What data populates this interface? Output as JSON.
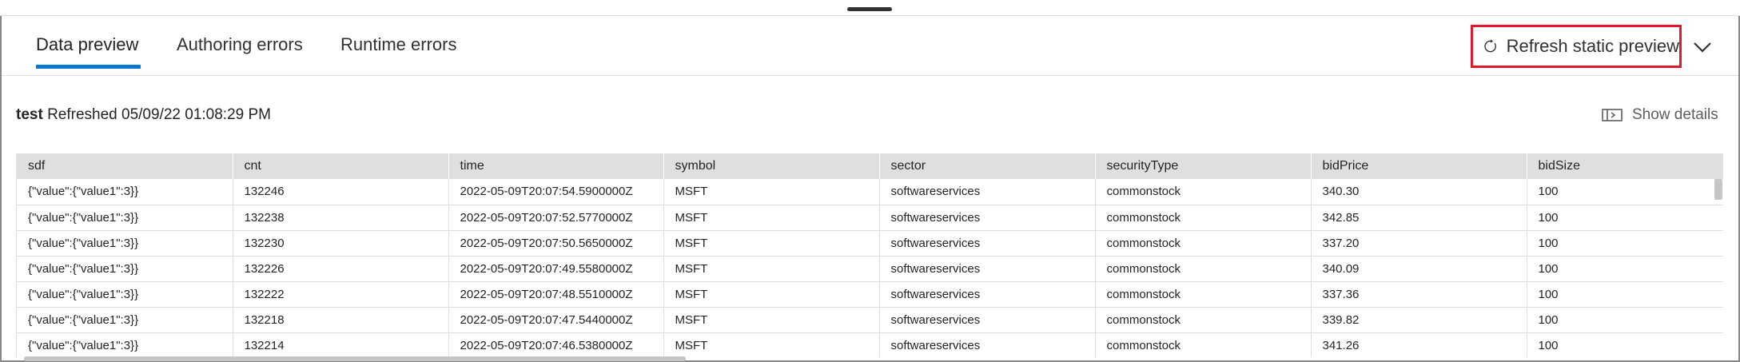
{
  "tabs": [
    {
      "label": "Data preview",
      "active": true
    },
    {
      "label": "Authoring errors",
      "active": false
    },
    {
      "label": "Runtime errors",
      "active": false
    }
  ],
  "toolbar": {
    "refresh_label": "Refresh static preview",
    "refresh_icon": "refresh-icon",
    "more_icon": "chevron-down-icon"
  },
  "status": {
    "name": "test",
    "refreshed": "Refreshed 05/09/22 01:08:29 PM"
  },
  "details": {
    "label": "Show details",
    "icon": "details-panel-icon"
  },
  "table": {
    "columns": [
      "sdf",
      "cnt",
      "time",
      "symbol",
      "sector",
      "securityType",
      "bidPrice",
      "bidSize"
    ],
    "rows": [
      [
        "{\"value\":{\"value1\":3}}",
        "132246",
        "2022-05-09T20:07:54.5900000Z",
        "MSFT",
        "softwareservices",
        "commonstock",
        "340.30",
        "100"
      ],
      [
        "{\"value\":{\"value1\":3}}",
        "132238",
        "2022-05-09T20:07:52.5770000Z",
        "MSFT",
        "softwareservices",
        "commonstock",
        "342.85",
        "100"
      ],
      [
        "{\"value\":{\"value1\":3}}",
        "132230",
        "2022-05-09T20:07:50.5650000Z",
        "MSFT",
        "softwareservices",
        "commonstock",
        "337.20",
        "100"
      ],
      [
        "{\"value\":{\"value1\":3}}",
        "132226",
        "2022-05-09T20:07:49.5580000Z",
        "MSFT",
        "softwareservices",
        "commonstock",
        "340.09",
        "100"
      ],
      [
        "{\"value\":{\"value1\":3}}",
        "132222",
        "2022-05-09T20:07:48.5510000Z",
        "MSFT",
        "softwareservices",
        "commonstock",
        "337.36",
        "100"
      ],
      [
        "{\"value\":{\"value1\":3}}",
        "132218",
        "2022-05-09T20:07:47.5440000Z",
        "MSFT",
        "softwareservices",
        "commonstock",
        "339.82",
        "100"
      ],
      [
        "{\"value\":{\"value1\":3}}",
        "132214",
        "2022-05-09T20:07:46.5380000Z",
        "MSFT",
        "softwareservices",
        "commonstock",
        "341.26",
        "100"
      ]
    ]
  },
  "colors": {
    "accent": "#0078d4",
    "highlight": "#e0182b",
    "header_bg": "#e1dfdd"
  }
}
